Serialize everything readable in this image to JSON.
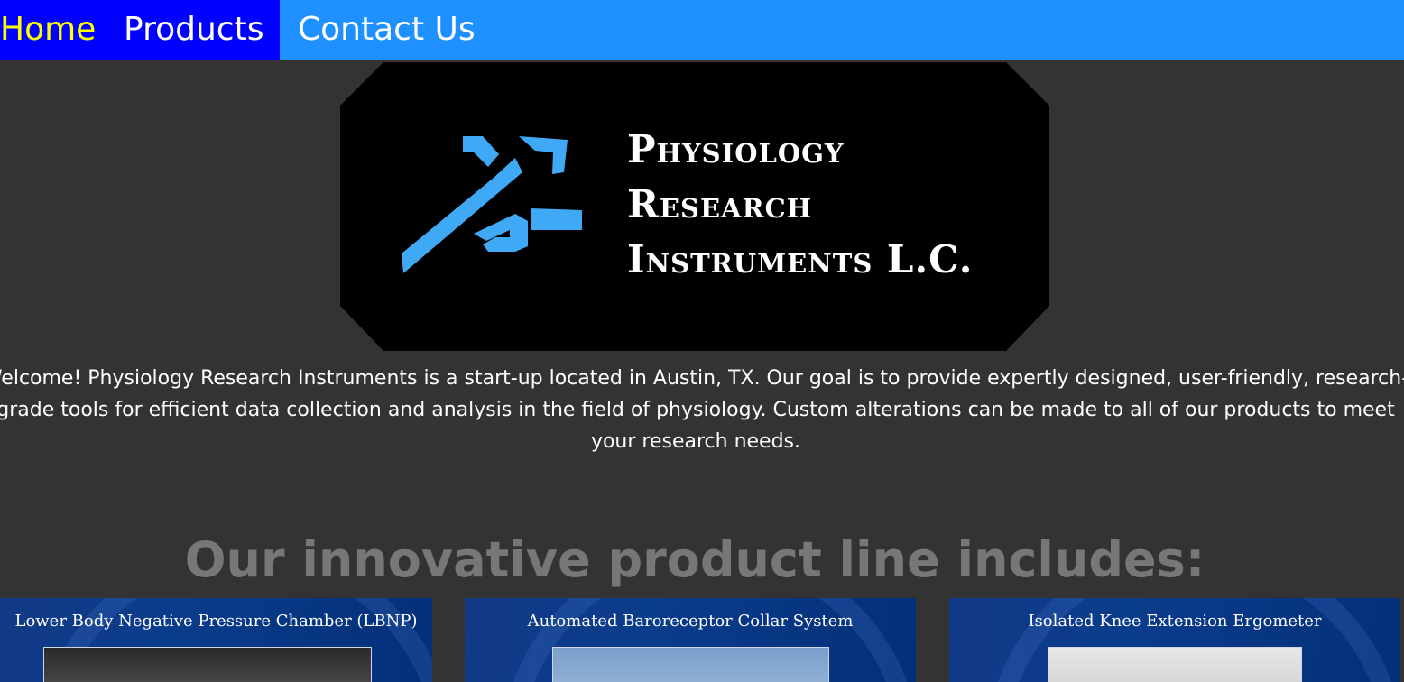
{
  "nav": {
    "items": [
      {
        "label": "Home"
      },
      {
        "label": "Products"
      },
      {
        "label": "Contact Us"
      }
    ]
  },
  "logo": {
    "lines": [
      "Physiology",
      "Research",
      "Instruments L.C."
    ],
    "icon": "running-figure-icon",
    "accent_color": "#3fa9f5"
  },
  "intro": {
    "text": "Welcome! Physiology Research Instruments is a start-up located in Austin, TX. Our goal is to provide expertly designed, user-friendly, research-grade tools for efficient data collection and analysis in the field of physiology. Custom alterations can be made to all of our products to meet your research needs."
  },
  "products": {
    "heading": "Our innovative product line includes:",
    "items": [
      {
        "title": "Lower Body Negative Pressure Chamber (LBNP)"
      },
      {
        "title": "Automated Baroreceptor Collar System"
      },
      {
        "title": "Isolated Knee Extension Ergometer"
      }
    ]
  },
  "colors": {
    "nav_bar": "#1e90ff",
    "nav_active_bg": "#0000ff",
    "nav_active_text": "#ffff00",
    "page_bg": "#333333",
    "heading_text": "#777777"
  }
}
